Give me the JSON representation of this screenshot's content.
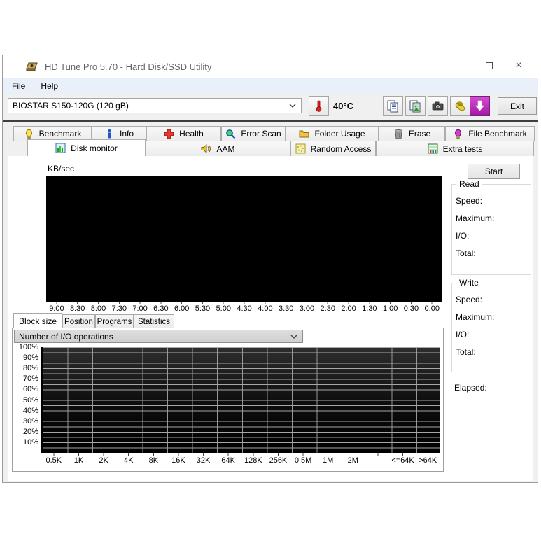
{
  "window": {
    "title": "HD Tune Pro 5.70 - Hard Disk/SSD Utility"
  },
  "icons": {
    "close_glyph": "×",
    "minimize-icon": "css-line",
    "maximize-icon": "css-box",
    "app_logo": "gold-disk"
  },
  "menu": {
    "items": [
      {
        "label": "File"
      },
      {
        "label": "Help"
      }
    ]
  },
  "toolbar": {
    "device_select": {
      "value": "BIOSTAR S150-120G (120 gB)"
    },
    "temperature": "40°C",
    "exit_label": "Exit"
  },
  "tabs": {
    "row1": [
      {
        "label": "Benchmark",
        "icon": "bulb-icon"
      },
      {
        "label": "Info",
        "icon": "info-icon"
      },
      {
        "label": "Health",
        "icon": "health-cross-icon"
      },
      {
        "label": "Error Scan",
        "icon": "magnifier-icon"
      },
      {
        "label": "Folder Usage",
        "icon": "folder-icon"
      },
      {
        "label": "Erase",
        "icon": "trash-icon"
      },
      {
        "label": "File Benchmark",
        "icon": "purple-bulb-icon"
      }
    ],
    "row2": [
      {
        "label": "Disk monitor",
        "icon": "disk-chart-icon",
        "active": true
      },
      {
        "label": "AAM",
        "icon": "speaker-icon"
      },
      {
        "label": "Random Access",
        "icon": "random-blocks-icon"
      },
      {
        "label": "Extra tests",
        "icon": "extra-tests-chart-icon"
      }
    ]
  },
  "monitor": {
    "unit_label": "KB/sec",
    "start_button": "Start",
    "time_labels": [
      "9:00",
      "8:30",
      "8:00",
      "7:30",
      "7:00",
      "6:30",
      "6:00",
      "5:30",
      "5:00",
      "4:30",
      "4:00",
      "3:30",
      "3:00",
      "2:30",
      "2:00",
      "1:30",
      "1:00",
      "0:30",
      "0:00"
    ],
    "read_panel": {
      "title": "Read",
      "fields": [
        "Speed:",
        "Maximum:",
        "I/O:",
        "Total:"
      ]
    },
    "write_panel": {
      "title": "Write",
      "fields": [
        "Speed:",
        "Maximum:",
        "I/O:",
        "Total:"
      ]
    },
    "elapsed_label": "Elapsed:"
  },
  "bottom": {
    "tabs": [
      "Block size",
      "Position",
      "Programs",
      "Statistics"
    ],
    "metric_select": {
      "value": "Number of I/O operations"
    },
    "percent_labels": [
      "100%",
      "90%",
      "80%",
      "70%",
      "60%",
      "50%",
      "40%",
      "30%",
      "20%",
      "10%"
    ],
    "block_labels": [
      "0.5K",
      "1K",
      "2K",
      "4K",
      "8K",
      "16K",
      "32K",
      "64K",
      "128K",
      "256K",
      "0.5M",
      "1M",
      "2M",
      "",
      "<=64K",
      ">64K"
    ]
  }
}
